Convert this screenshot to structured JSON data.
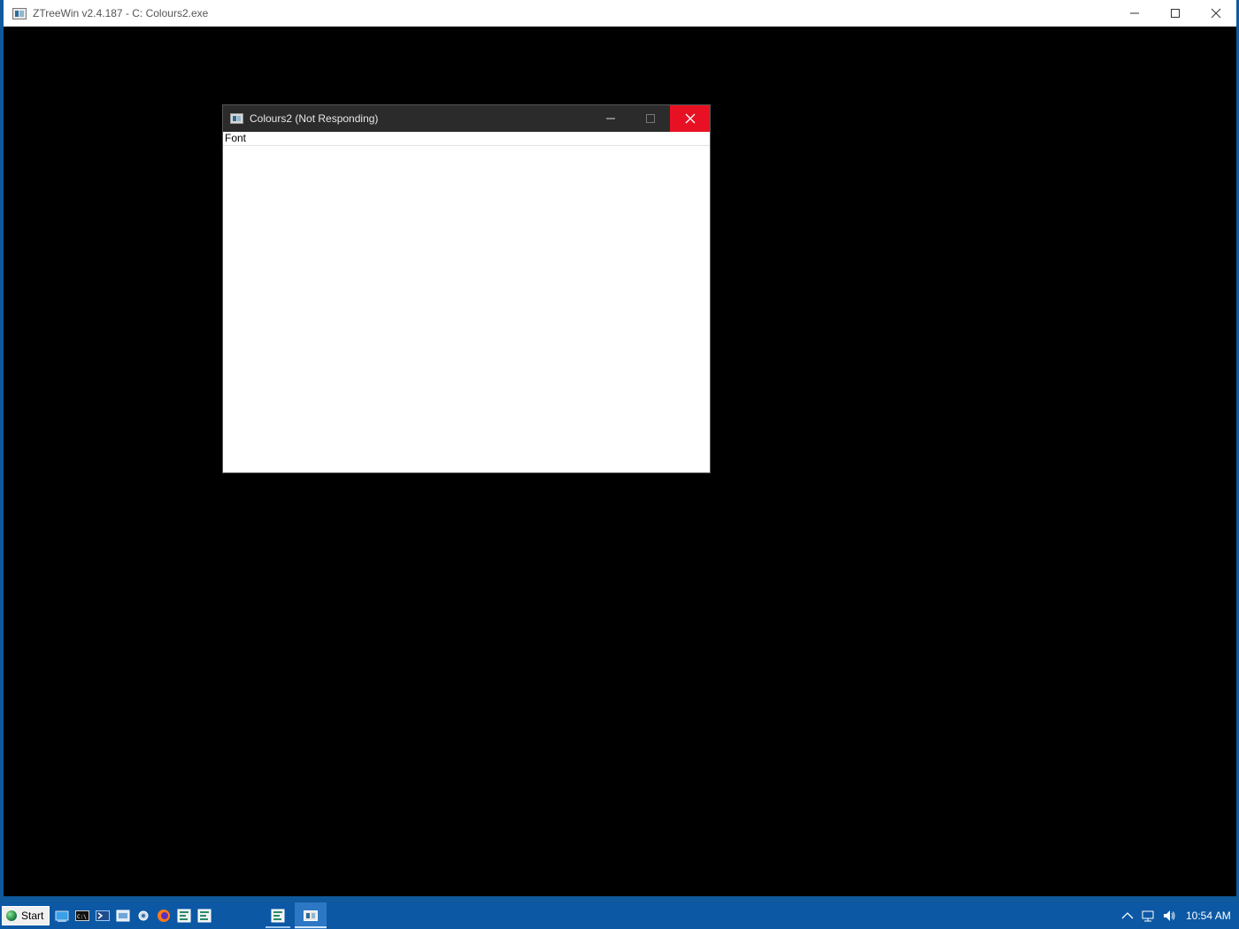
{
  "main_window": {
    "title": "ZTreeWin v2.4.187 - C: Colours2.exe"
  },
  "dialog": {
    "title": "Colours2 (Not Responding)",
    "menu": [
      "Font"
    ]
  },
  "taskbar": {
    "start_label": "Start",
    "clock": "10:54 AM",
    "pinned_icons": [
      "explorer-icon",
      "cmd-icon",
      "powershell-icon",
      "control-panel-icon",
      "settings-icon",
      "firefox-icon",
      "ztree-icon",
      "ztree-icon"
    ],
    "running_icons": [
      "ztree-icon",
      "colours2-icon"
    ]
  },
  "colors": {
    "desktop": "#0f5a9c",
    "close_red": "#e81123",
    "dialog_titlebar": "#2b2b2b"
  }
}
